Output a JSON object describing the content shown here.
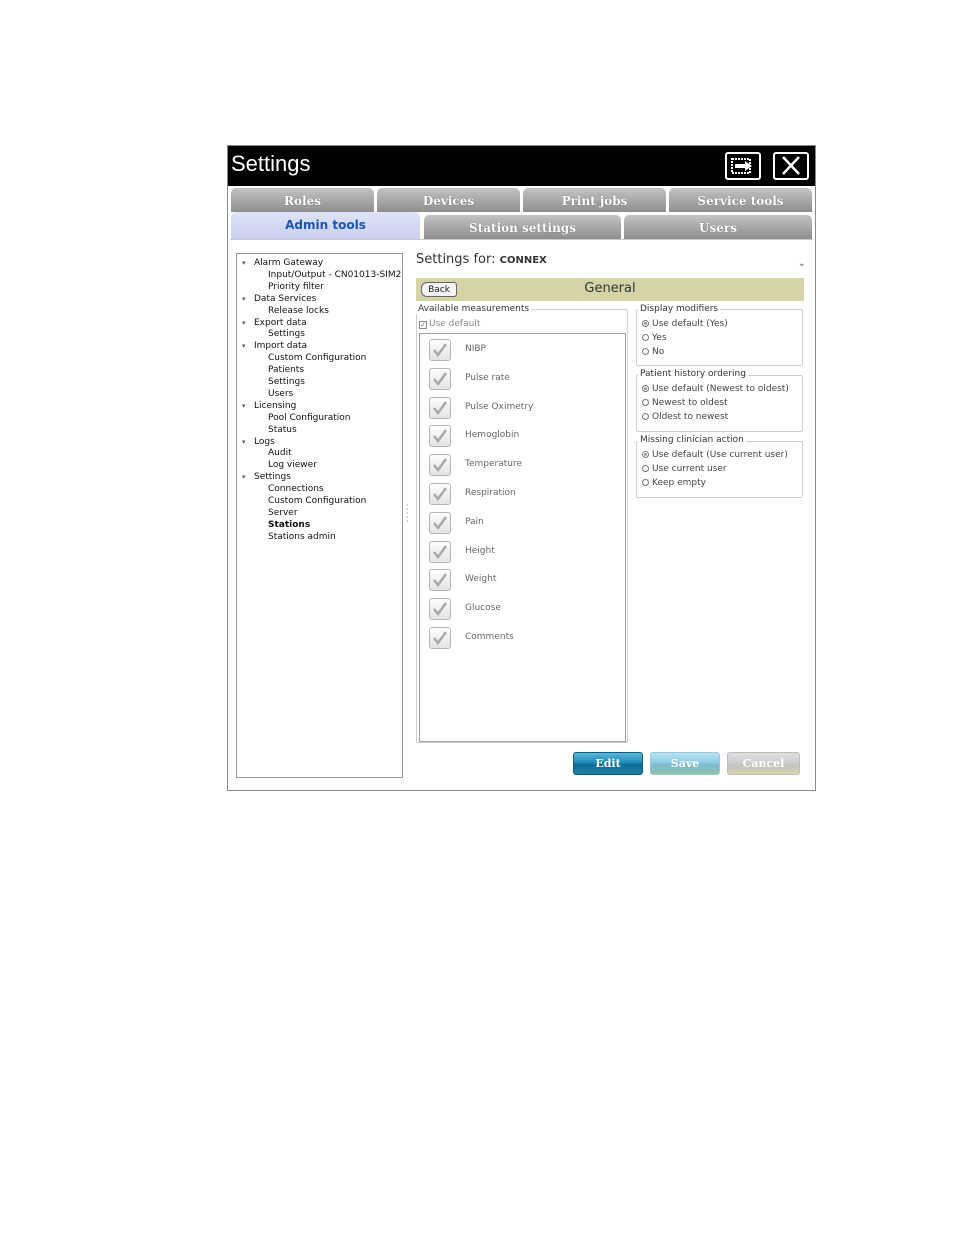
{
  "window": {
    "title": "Settings"
  },
  "tabs_row1": [
    "Roles",
    "Devices",
    "Print jobs",
    "Service tools"
  ],
  "tabs_row2": [
    "Admin tools",
    "Station settings",
    "Users"
  ],
  "tree": [
    {
      "label": "Alarm Gateway",
      "level": 0,
      "expanded": true
    },
    {
      "label": "Input/Output - CN01013-SIM2",
      "level": 1
    },
    {
      "label": "Priority filter",
      "level": 1
    },
    {
      "label": "Data Services",
      "level": 0,
      "expanded": true
    },
    {
      "label": "Release locks",
      "level": 1
    },
    {
      "label": "Export data",
      "level": 0,
      "expanded": true
    },
    {
      "label": "Settings",
      "level": 1
    },
    {
      "label": "Import data",
      "level": 0,
      "expanded": true
    },
    {
      "label": "Custom Configuration",
      "level": 1
    },
    {
      "label": "Patients",
      "level": 1
    },
    {
      "label": "Settings",
      "level": 1
    },
    {
      "label": "Users",
      "level": 1
    },
    {
      "label": "Licensing",
      "level": 0,
      "expanded": true
    },
    {
      "label": "Pool Configuration",
      "level": 1
    },
    {
      "label": "Status",
      "level": 1
    },
    {
      "label": "Logs",
      "level": 0,
      "expanded": true
    },
    {
      "label": "Audit",
      "level": 1
    },
    {
      "label": "Log viewer",
      "level": 1
    },
    {
      "label": "Settings",
      "level": 0,
      "expanded": true
    },
    {
      "label": "Connections",
      "level": 1
    },
    {
      "label": "Custom Configuration",
      "level": 1
    },
    {
      "label": "Server",
      "level": 1
    },
    {
      "label": "Stations",
      "level": 1,
      "selected": true
    },
    {
      "label": "Stations admin",
      "level": 1
    }
  ],
  "settings_for": {
    "label": "Settings for:",
    "value": "CONNEX"
  },
  "general": {
    "back_label": "Back",
    "title": "General"
  },
  "measurements": {
    "group_label": "Available measurements",
    "use_default_label": "Use default",
    "items": [
      "NIBP",
      "Pulse rate",
      "Pulse Oximetry",
      "Hemoglobin",
      "Temperature",
      "Respiration",
      "Pain",
      "Height",
      "Weight",
      "Glucose",
      "Comments"
    ]
  },
  "display_modifiers": {
    "label": "Display modifiers",
    "options": [
      "Use default (Yes)",
      "Yes",
      "No"
    ]
  },
  "history_ordering": {
    "label": "Patient history ordering",
    "options": [
      "Use default (Newest to oldest)",
      "Newest to oldest",
      "Oldest to newest"
    ]
  },
  "missing_clinician": {
    "label": "Missing clinician action",
    "options": [
      "Use default (Use current user)",
      "Use current user",
      "Keep empty"
    ]
  },
  "actions": {
    "edit": "Edit",
    "save": "Save",
    "cancel": "Cancel"
  }
}
